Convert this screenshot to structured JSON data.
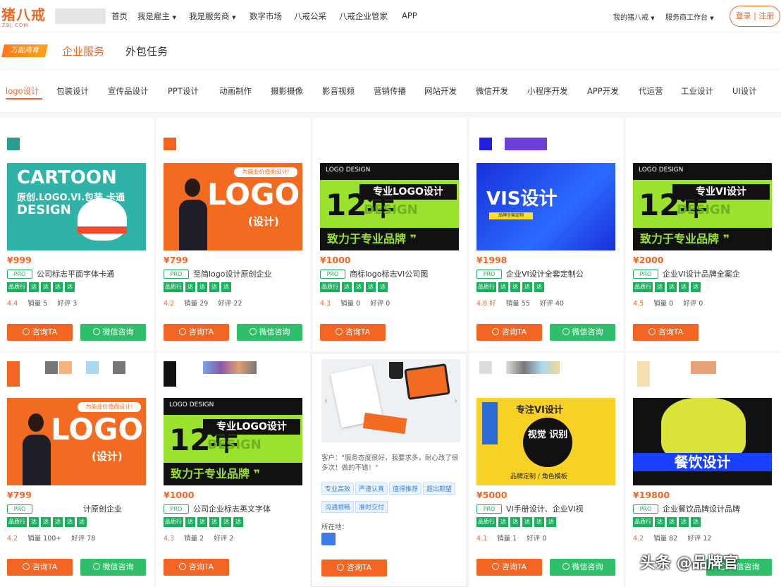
{
  "header": {
    "logo_main": "猪八戒",
    "logo_sub": "ZBJ.COM",
    "nav": [
      "首页",
      "我是雇主",
      "我是服务商",
      "数字市场",
      "八戒公采",
      "八戒企业管家",
      "APP"
    ],
    "right": [
      "我的猪八戒",
      "服务商工作台"
    ],
    "login": "登录 | 注册"
  },
  "service_bar": {
    "badge": "万能商育",
    "tabs": [
      "企业服务",
      "外包任务"
    ]
  },
  "categories": [
    "logo设计",
    "包装设计",
    "宣传品设计",
    "PPT设计",
    "动画制作",
    "摄影摄像",
    "影音视频",
    "营销传播",
    "网站开发",
    "微信开发",
    "小程序开发",
    "APP开发",
    "代运营",
    "工业设计",
    "UI设计"
  ],
  "cards_row1": [
    {
      "price": "¥999",
      "title": "公司标志平面字体卡通",
      "rating": "4.4",
      "sales": "销量",
      "sales_v": "5",
      "reviews": "好评",
      "reviews_v": "3",
      "banner": {
        "t1": "CARTOON",
        "t2": "原创.LOGO.VI.包装.卡通",
        "t3": "DESIGN"
      }
    },
    {
      "price": "¥799",
      "title": "至简logo设计原创企业",
      "rating": "4.2",
      "sales": "销量",
      "sales_v": "29",
      "reviews": "好评",
      "reviews_v": "22",
      "banner": {
        "pill": "为商业价值而设计!",
        "big": "LOGO",
        "sm": "(设计)"
      }
    },
    {
      "price": "¥1000",
      "title": "商标logo标志VI公司图",
      "rating": "4.3",
      "sales": "销量",
      "sales_v": "0",
      "reviews": "好评",
      "reviews_v": "0",
      "banner": {
        "ld": "LOGO DESIGN",
        "n12": "12年",
        "hd": "专业LOGO设计",
        "ds": "DESIGN",
        "ft": "致力于专业品牌 ❞"
      }
    },
    {
      "price": "¥1998",
      "title": "企业VI设计全套定制公",
      "rating": "4.8 好",
      "sales": "销量",
      "sales_v": "55",
      "reviews": "好评",
      "reviews_v": "40",
      "banner": {
        "v": "VIS设计",
        "s": "品牌全案定制"
      }
    },
    {
      "price": "¥2000",
      "title": "企业VI设计品牌全案企",
      "rating": "4.5",
      "sales": "销量",
      "sales_v": "0",
      "reviews": "好评",
      "reviews_v": "0",
      "banner": {
        "ld": "LOGO DESIGN",
        "n12": "12年",
        "hd": "专业VI设计",
        "ds": "DESIGN",
        "ft": "致力于专业品牌 ❞"
      }
    }
  ],
  "cards_row2": [
    {
      "price": "¥799",
      "title": "计原创企业",
      "rating": "4.2",
      "sales": "销量",
      "sales_v": "100+",
      "reviews": "好评",
      "reviews_v": "78",
      "banner": {
        "pill": "为商业价值而设计!",
        "big": "LOGO",
        "sm": "(设计)"
      }
    },
    {
      "price": "¥1000",
      "title": "公司企业标志英文字体",
      "rating": "4.3",
      "sales": "销量",
      "sales_v": "2",
      "reviews": "好评",
      "reviews_v": "2",
      "banner": {
        "ld": "LOGO DESIGN",
        "n12": "12年",
        "hd": "专业LOGO设计",
        "ds": "DESIGN",
        "ft": "致力于专业品牌 ❞"
      }
    },
    {
      "testimonial": "客户：\"服务态度很好，我要求多，耐心改了很多次！做的不错！\"",
      "tags": [
        "专业高效",
        "严谨认真",
        "值得推荐",
        "超出期望",
        "沟通顺畅",
        "准时交付"
      ],
      "location": "所在地："
    },
    {
      "price": "¥5000",
      "title": "VI手册设计、企业VI视",
      "rating": "4.1",
      "sales": "销量",
      "sales_v": "1",
      "reviews": "好评",
      "reviews_v": "0",
      "banner": {
        "h": "专注VI设计",
        "c": "视觉 识别",
        "f": "品牌定制 / 角色模板"
      }
    },
    {
      "price": "¥19800",
      "title": "企业餐饮品牌设计品牌",
      "rating": "4.2",
      "sales": "销量",
      "sales_v": "82",
      "reviews": "好评",
      "reviews_v": "12",
      "banner": {
        "stripe": "餐饮设计"
      }
    }
  ],
  "common": {
    "pro": "PRO",
    "tag1": "品质行",
    "tag_s": "达",
    "ask": "咨询TA",
    "wechat": "微信咨询"
  },
  "watermark": "头条 @品牌官",
  "colors": {
    "accent": "#f26522",
    "green": "#19b05c",
    "wechat": "#2fbf6a",
    "blue": "#3b82d6"
  }
}
